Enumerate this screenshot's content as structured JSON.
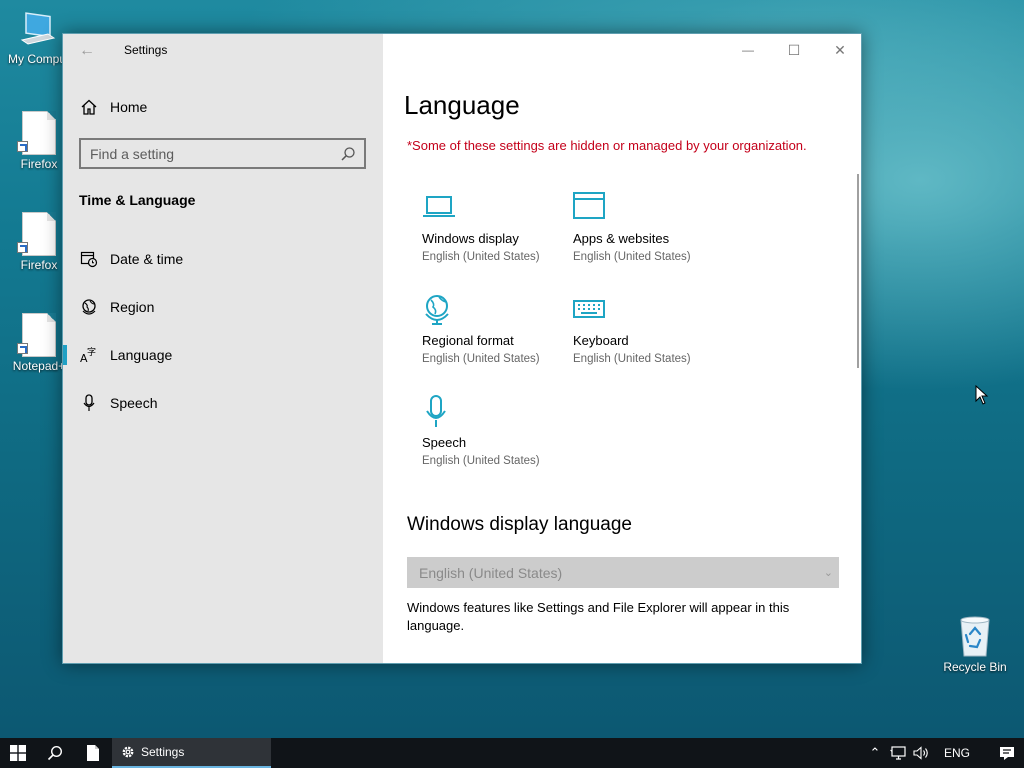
{
  "desktop": {
    "icons": [
      {
        "label": "My Compu",
        "icon": "computer-icon"
      },
      {
        "label": "Firefox",
        "icon": "document-icon"
      },
      {
        "label": "Firefox",
        "icon": "document-icon"
      },
      {
        "label": "Notepad+",
        "icon": "document-icon"
      },
      {
        "label": "Recycle Bin",
        "icon": "recycle-bin-icon"
      }
    ]
  },
  "window": {
    "title": "Settings",
    "controls": {
      "minimize": "—",
      "maximize": "☐",
      "close": "✕"
    }
  },
  "sidebar": {
    "home_label": "Home",
    "search_placeholder": "Find a setting",
    "section_title": "Time & Language",
    "items": [
      {
        "label": "Date & time",
        "icon": "calendar-clock-icon",
        "active": false
      },
      {
        "label": "Region",
        "icon": "globe-icon",
        "active": false
      },
      {
        "label": "Language",
        "icon": "language-icon",
        "active": true
      },
      {
        "label": "Speech",
        "icon": "microphone-icon",
        "active": false
      }
    ]
  },
  "main": {
    "title": "Language",
    "org_warning": "*Some of these settings are hidden or managed by your organization.",
    "tiles": [
      {
        "name": "Windows display",
        "sub": "English (United States)",
        "icon": "laptop-icon"
      },
      {
        "name": "Apps & websites",
        "sub": "English (United States)",
        "icon": "browser-window-icon"
      },
      {
        "name": "Regional format",
        "sub": "English (United States)",
        "icon": "globe-stand-icon"
      },
      {
        "name": "Keyboard",
        "sub": "English (United States)",
        "icon": "keyboard-icon"
      },
      {
        "name": "Speech",
        "sub": "English (United States)",
        "icon": "microphone-icon"
      }
    ],
    "display_language_heading": "Windows display language",
    "display_language_value": "English (United States)",
    "display_language_desc": "Windows features like Settings and File Explorer will appear in this language."
  },
  "taskbar": {
    "active_app": "Settings",
    "tray_language": "ENG"
  },
  "colors": {
    "accent": "#1fa0c4",
    "warning": "#c4001a",
    "tile_icon": "#1ea5c4"
  }
}
